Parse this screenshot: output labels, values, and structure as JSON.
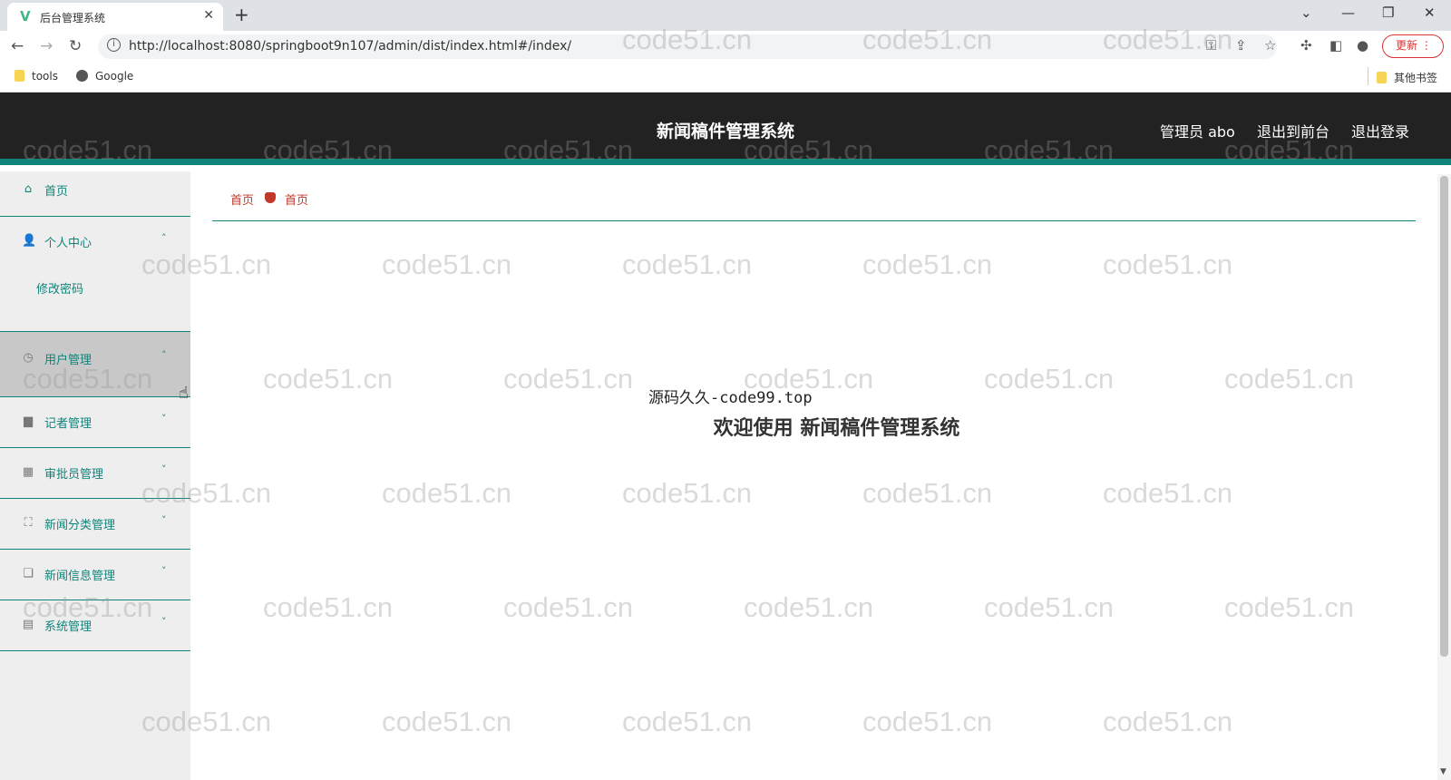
{
  "browser": {
    "tab_title": "后台管理系统",
    "tab_favicon": "V",
    "url": "http://localhost:8080/springboot9n107/admin/dist/index.html#/index/",
    "update_label": "更新",
    "bookmarks": [
      "tools",
      "Google"
    ],
    "other_bookmarks": "其他书签"
  },
  "header": {
    "title": "新闻稿件管理系统",
    "admin_label": "管理员 abo",
    "to_front_label": "退出到前台",
    "logout_label": "退出登录"
  },
  "sidebar": {
    "items": [
      {
        "label": "首页",
        "icon": "home-icon"
      },
      {
        "label": "个人中心",
        "icon": "user-icon",
        "expanded": true,
        "children": [
          "修改密码"
        ]
      },
      {
        "label": "用户管理",
        "icon": "user-manage-icon"
      },
      {
        "label": "记者管理",
        "icon": "reporter-icon"
      },
      {
        "label": "审批员管理",
        "icon": "grid-icon"
      },
      {
        "label": "新闻分类管理",
        "icon": "category-icon"
      },
      {
        "label": "新闻信息管理",
        "icon": "news-icon"
      },
      {
        "label": "系统管理",
        "icon": "system-icon"
      }
    ]
  },
  "breadcrumb": [
    "首页",
    "首页"
  ],
  "content": {
    "promo": "源码久久-code99.top",
    "welcome": "欢迎使用 新闻稿件管理系统"
  },
  "watermark": "code51.cn",
  "colors": {
    "accent": "#10847a",
    "header_bg": "#222222",
    "breadcrumb": "#c0392b"
  }
}
